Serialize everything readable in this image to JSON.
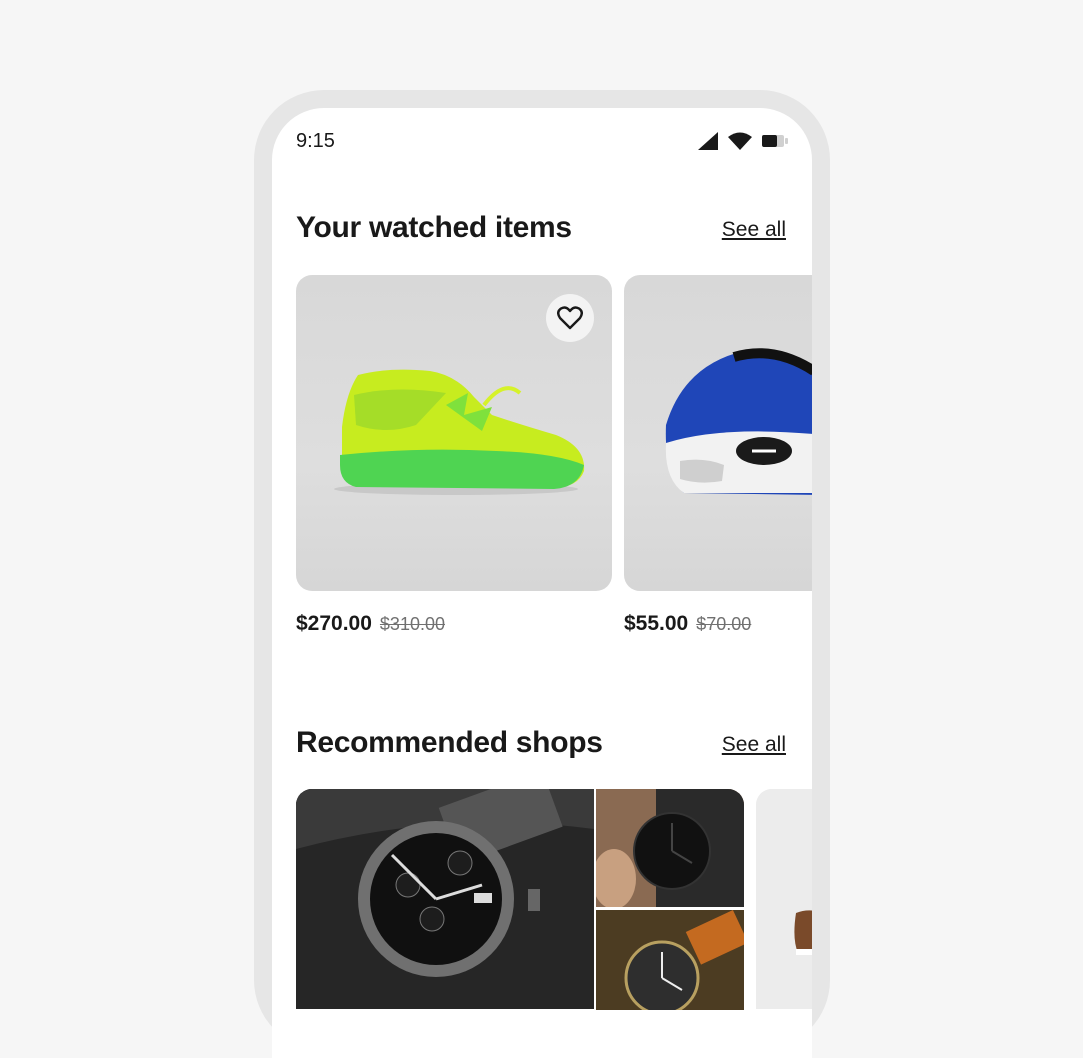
{
  "status_bar": {
    "time": "9:15",
    "icons": [
      "signal-icon",
      "wifi-icon",
      "battery-icon"
    ]
  },
  "watched": {
    "title": "Your watched items",
    "see_all": "See all",
    "items": [
      {
        "image": "green basketball sneaker",
        "price": "$270.00",
        "old_price": "$310.00",
        "watched": true
      },
      {
        "image": "blue white sneaker",
        "price": "$55.00",
        "old_price": "$70.00"
      }
    ]
  },
  "shops": {
    "title": "Recommended shops",
    "see_all": "See all",
    "tiles": [
      "black chronograph watch",
      "minimal black watch",
      "brown leather strap watch",
      "shoe product"
    ]
  },
  "colors": {
    "background": "#f6f6f6",
    "frame": "#e6e6e6",
    "text": "#191919",
    "muted": "#707070"
  }
}
